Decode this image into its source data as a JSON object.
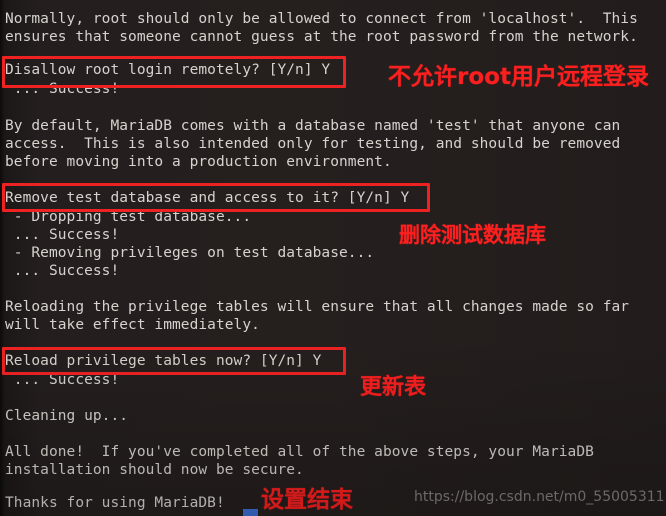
{
  "terminal": {
    "background_color": "#241f1e",
    "text_color": "#d6d2cd",
    "annotation_color": "#fb1f1f",
    "highlight_box_color": "#ee2222",
    "cursor_color": "#3b6fd4",
    "lines": [
      "Normally, root should only be allowed to connect from 'localhost'.  This",
      "ensures that someone cannot guess at the root password from the network.",
      "",
      "Disallow root login remotely? [Y/n] Y",
      " ... Success!",
      "",
      "By default, MariaDB comes with a database named 'test' that anyone can",
      "access.  This is also intended only for testing, and should be removed",
      "before moving into a production environment.",
      "",
      "Remove test database and access to it? [Y/n] Y",
      " - Dropping test database...",
      " ... Success!",
      " - Removing privileges on test database...",
      " ... Success!",
      "",
      "Reloading the privilege tables will ensure that all changes made so far",
      "will take effect immediately.",
      "",
      "Reload privilege tables now? [Y/n] Y",
      " ... Success!",
      "",
      "Cleaning up...",
      "",
      "All done!  If you've completed all of the above steps, your MariaDB",
      "installation should now be secure.",
      "",
      "Thanks for using MariaDB!"
    ]
  },
  "highlights": [
    {
      "label": "disallow-root-login-prompt"
    },
    {
      "label": "remove-test-database-prompt"
    },
    {
      "label": "reload-privilege-tables-prompt"
    }
  ],
  "annotations": [
    {
      "text": "不允许root用户远程登录"
    },
    {
      "text": "删除测试数据库"
    },
    {
      "text": "更新表"
    },
    {
      "text": "设置结束"
    }
  ],
  "watermark": {
    "text": "https://blog.csdn.net/m0_55005311"
  }
}
